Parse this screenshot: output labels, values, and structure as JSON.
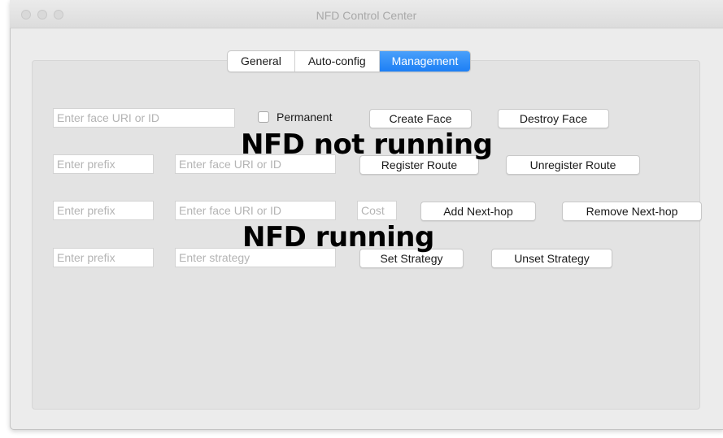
{
  "window": {
    "title": "NFD Control Center"
  },
  "tabs": [
    {
      "label": "General",
      "active": false
    },
    {
      "label": "Auto-config",
      "active": false
    },
    {
      "label": "Management",
      "active": true
    }
  ],
  "face_row": {
    "uri_placeholder": "Enter face URI or ID",
    "permanent_label": "Permanent",
    "permanent_checked": false,
    "create_label": "Create Face",
    "destroy_label": "Destroy Face"
  },
  "route_row": {
    "prefix_placeholder": "Enter prefix",
    "uri_placeholder": "Enter face URI or ID",
    "register_label": "Register Route",
    "unregister_label": "Unregister Route"
  },
  "nexthop_row": {
    "prefix_placeholder": "Enter prefix",
    "uri_placeholder": "Enter face URI or ID",
    "cost_placeholder": "Cost",
    "add_label": "Add Next-hop",
    "remove_label": "Remove Next-hop"
  },
  "strategy_row": {
    "prefix_placeholder": "Enter prefix",
    "strategy_placeholder": "Enter strategy",
    "set_label": "Set Strategy",
    "unset_label": "Unset Strategy"
  },
  "overlays": {
    "not_running": "NFD not running",
    "running": "NFD running"
  },
  "colors": {
    "accent": "#1d7ff5",
    "window_bg": "#ececec"
  }
}
